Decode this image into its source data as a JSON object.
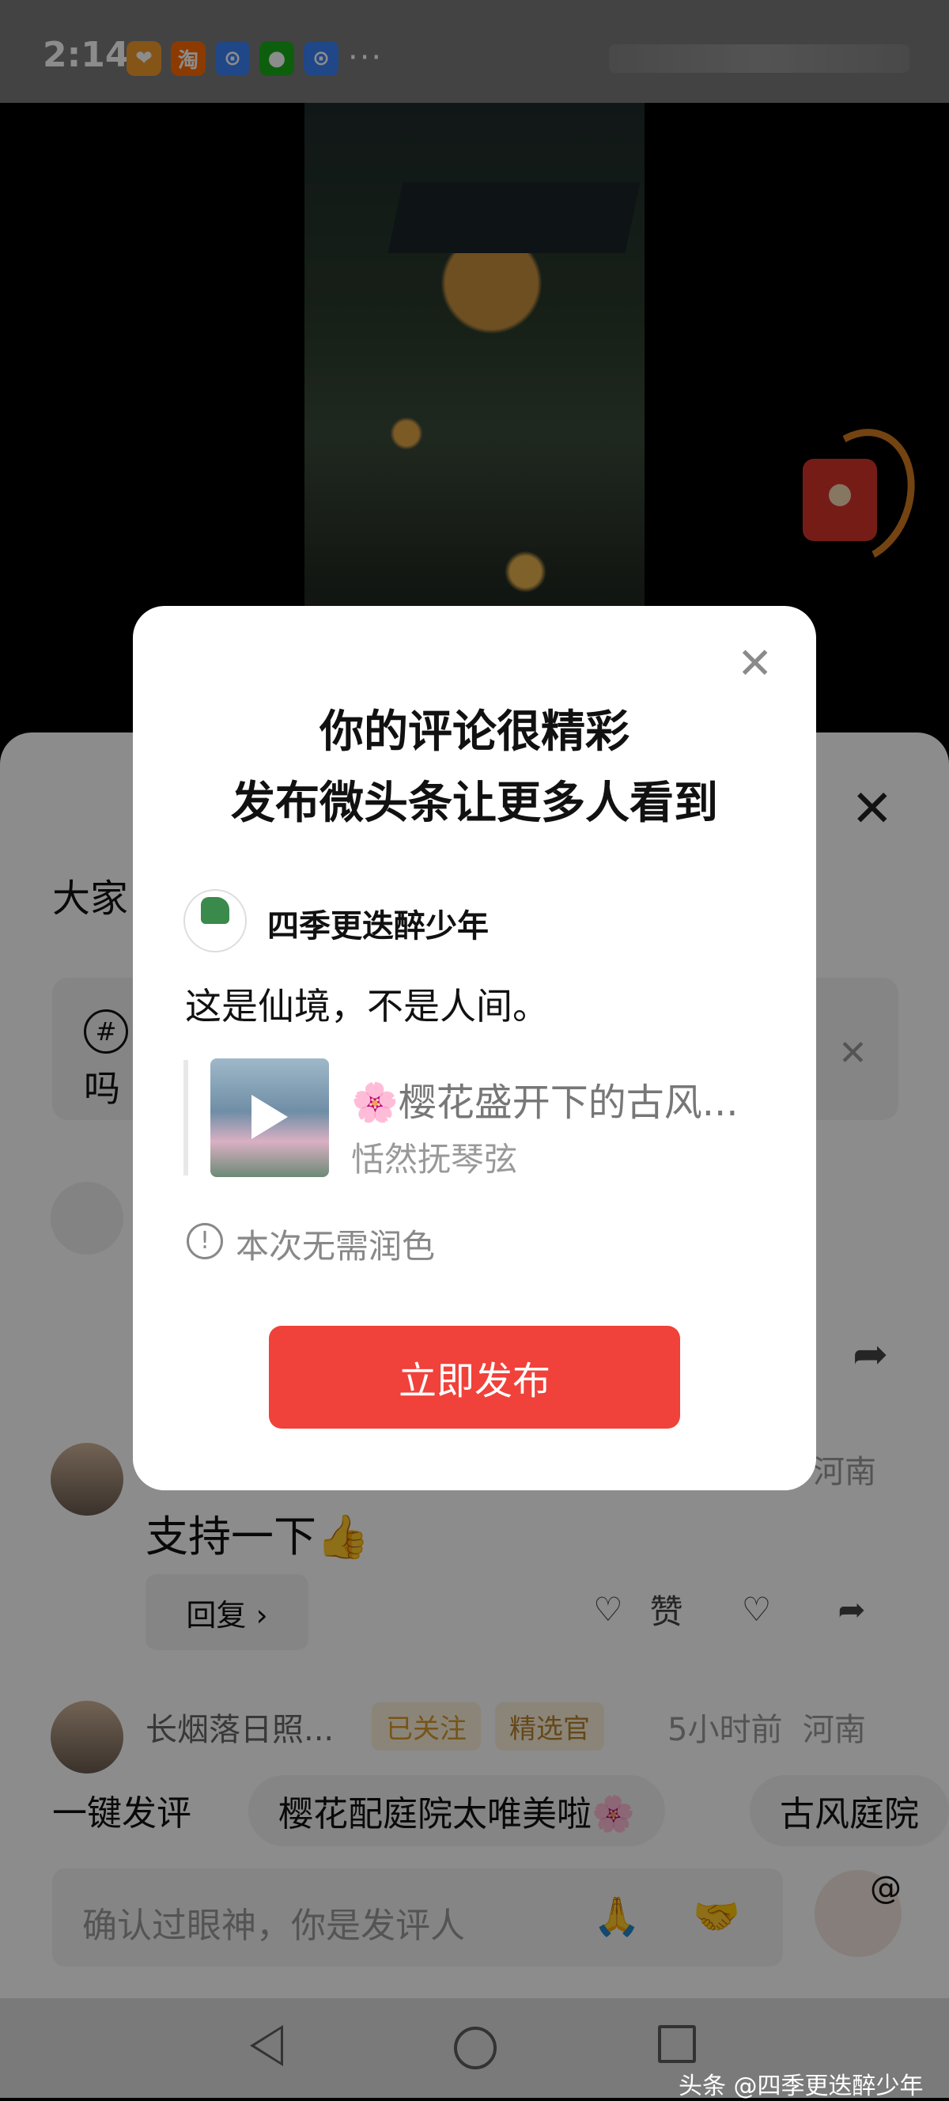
{
  "status_bar": {
    "time": "2:14",
    "app_icons": [
      {
        "name": "heart-app-icon",
        "glyph": "❤",
        "color": "#f39a2a"
      },
      {
        "name": "taobao-icon",
        "glyph": "淘",
        "color": "#ff6a00"
      },
      {
        "name": "lock-app-icon-1",
        "glyph": "⊙",
        "color": "#3b82f6"
      },
      {
        "name": "wechat-icon",
        "glyph": "●",
        "color": "#1aad19"
      },
      {
        "name": "lock-app-icon-2",
        "glyph": "⊙",
        "color": "#3b82f6"
      }
    ],
    "more": "···"
  },
  "sheet": {
    "title_partial": "大家",
    "topic_hash": "#",
    "topic_partial": "吗",
    "comments": [
      {
        "text": "支持一下👍",
        "location": "河南",
        "reply_label": "回复 ›",
        "like_label": "赞"
      },
      {
        "username": "长烟落日照...",
        "followed_tag": "已关注",
        "featured_tag": "精选官",
        "time": "5小时前",
        "location": "河南"
      }
    ],
    "quick_label": "一键发评",
    "chips": [
      "樱花配庭院太唯美啦🌸",
      "古风庭院"
    ],
    "input_placeholder": "确认过眼神，你是发评人",
    "input_emojis": [
      "🙏",
      "🤝"
    ],
    "at_symbol": "@"
  },
  "modal": {
    "title_line1": "你的评论很精彩",
    "title_line2": "发布微头条让更多人看到",
    "username": "四季更迭醉少年",
    "comment": "这是仙境，不是人间。",
    "video_title": "🌸樱花盛开下的古风...",
    "video_author": "恬然抚琴弦",
    "notice": "本次无需润色",
    "publish_button": "立即发布",
    "close_glyph": "✕"
  },
  "watermark": "头条 @四季更迭醉少年",
  "colors": {
    "accent": "#f0413a",
    "status": "#7a7a7a"
  }
}
